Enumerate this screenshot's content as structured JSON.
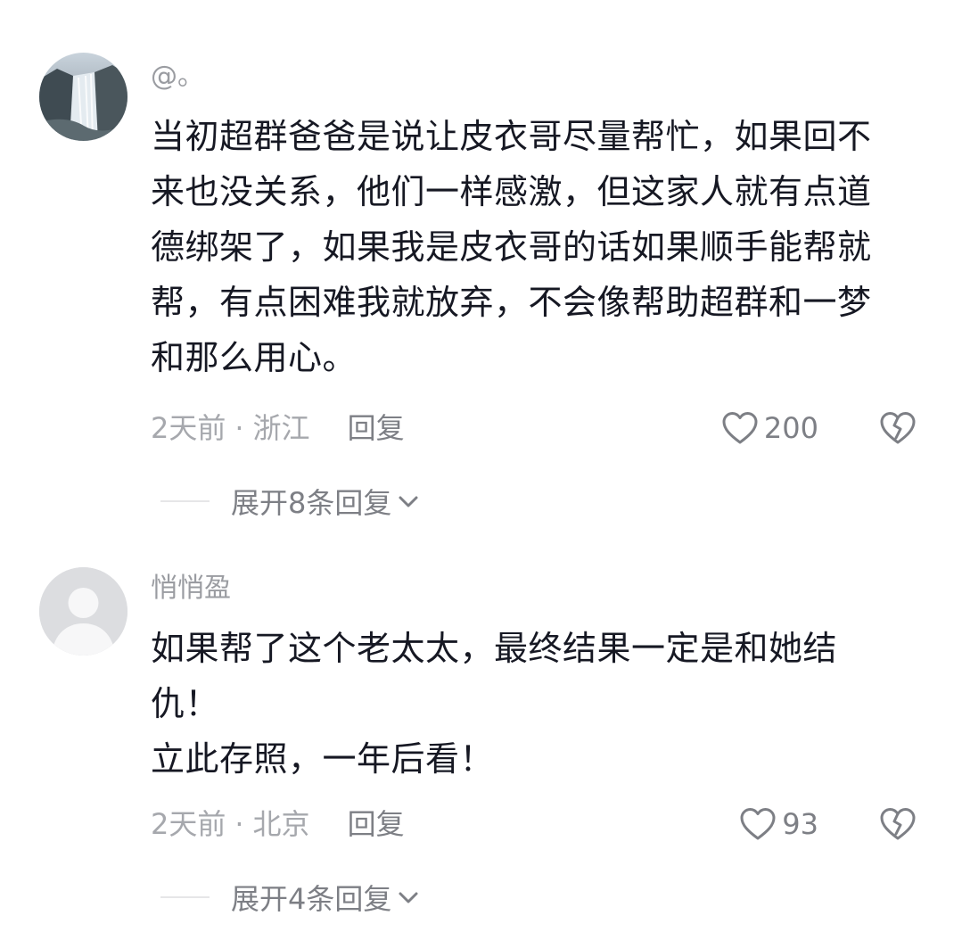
{
  "comments": [
    {
      "username": "@。",
      "avatar_icon": "waterfall-avatar",
      "lines": [
        "当初超群爸爸是说让皮衣哥尽量帮忙，如果回不",
        "来也没关系，他们一样感激，但这家人就有点道",
        "德绑架了，如果我是皮衣哥的话如果顺手能帮就",
        "帮，有点困难我就放弃，不会像帮助超群和一梦",
        "和那么用心。"
      ],
      "time": "2天前",
      "location": "浙江",
      "reply_label": "回复",
      "likes": "200",
      "expand_label": "展开8条回复"
    },
    {
      "username": "悄悄盈",
      "avatar_icon": "default-user-avatar",
      "lines": [
        "如果帮了这个老太太，最终结果一定是和她结",
        "仇！",
        "立此存照，一年后看！"
      ],
      "time": "2天前",
      "location": "北京",
      "reply_label": "回复",
      "likes": "93",
      "expand_label": "展开4条回复"
    }
  ],
  "colors": {
    "text_primary": "#161823",
    "text_secondary": "#9a9ca1",
    "text_action": "#7d7f85"
  }
}
